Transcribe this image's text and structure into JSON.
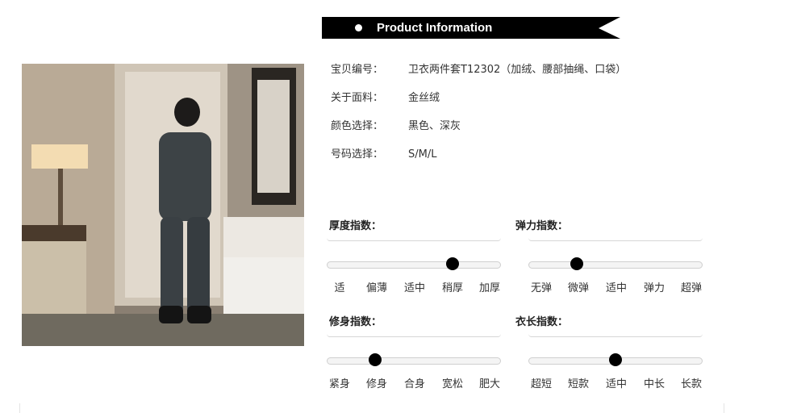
{
  "banner": {
    "title": "Product Information"
  },
  "info": [
    {
      "label": "宝贝编号：",
      "value": "卫衣两件套T12302（加绒、腰部抽绳、口袋）"
    },
    {
      "label": "关于面料：",
      "value": "金丝绒"
    },
    {
      "label": "颜色选择：",
      "value": "黑色、深灰"
    },
    {
      "label": "号码选择：",
      "value": "S/M/L"
    }
  ],
  "gauges": [
    {
      "title": "厚度指数：",
      "labels": [
        "适",
        "偏薄",
        "适中",
        "稍厚",
        "加厚"
      ],
      "value": 0.72
    },
    {
      "title": "弹力指数：",
      "labels": [
        "无弹",
        "微弹",
        "适中",
        "弹力",
        "超弹"
      ],
      "value": 0.28
    },
    {
      "title": "修身指数：",
      "labels": [
        "紧身",
        "修身",
        "合身",
        "宽松",
        "肥大"
      ],
      "value": 0.28
    },
    {
      "title": "衣长指数：",
      "labels": [
        "超短",
        "短款",
        "适中",
        "中长",
        "长款"
      ],
      "value": 0.5
    }
  ],
  "colors": {
    "banner": "#000000",
    "knob": "#000000",
    "track": "#f4f4f4"
  },
  "photo": {
    "icon": "product-photo"
  }
}
